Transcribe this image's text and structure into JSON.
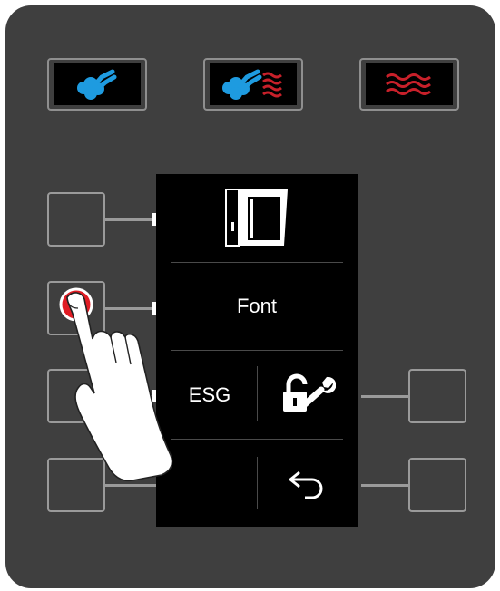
{
  "mode_buttons": [
    {
      "name": "steam-mode",
      "icon": "steam-icon"
    },
    {
      "name": "combi-mode",
      "icon": "combi-steam-convection-icon"
    },
    {
      "name": "convection-mode",
      "icon": "convection-heat-icon"
    }
  ],
  "screen": {
    "row1": {
      "icon": "cabinet-door-icon"
    },
    "row2": {
      "label": "Font"
    },
    "row3": {
      "left_label": "ESG",
      "right_icon": "unlock-wrench-icon"
    },
    "row4": {
      "right_icon": "back-arrow-icon"
    }
  },
  "colors": {
    "panel": "#3f3f3f",
    "steam_blue": "#1e9be0",
    "heat_red": "#c8202a",
    "press_indicator": "#e01c24"
  }
}
